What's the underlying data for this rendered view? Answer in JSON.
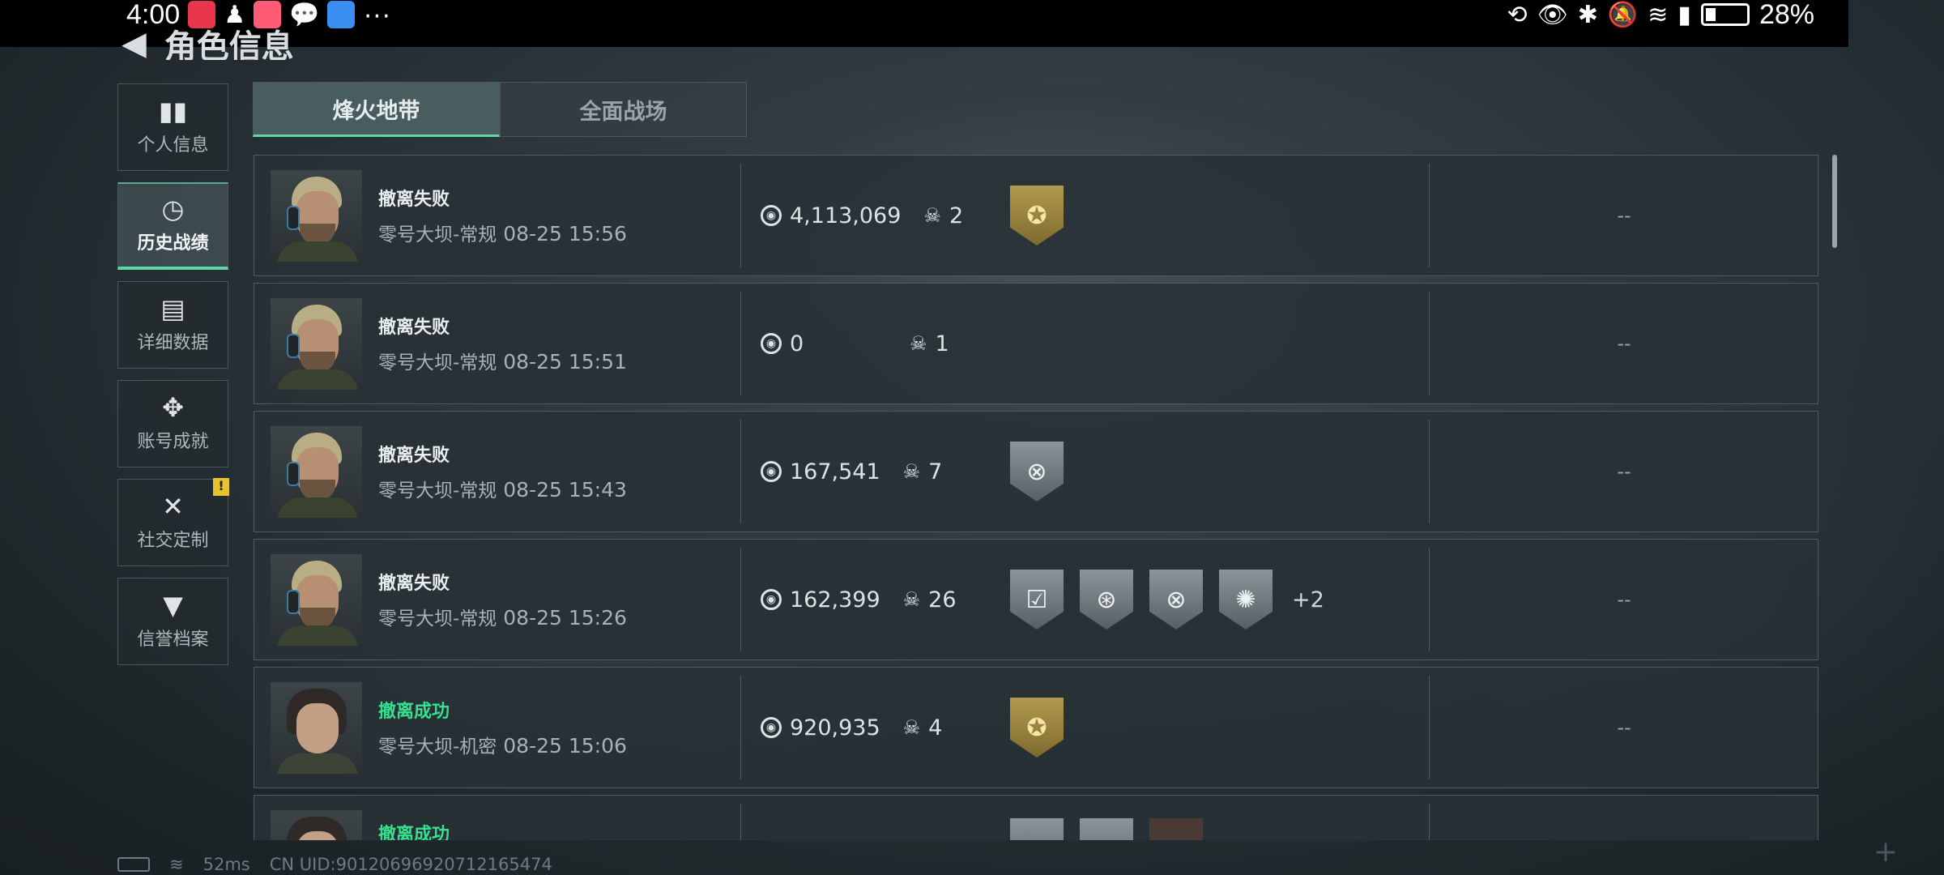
{
  "status_bar": {
    "time": "4:00",
    "more": "···",
    "battery": "28%",
    "colors": {
      "app1": "#e8364a",
      "app2": "#ff5a76",
      "app3": "#3a8ef0"
    }
  },
  "page_title": "角色信息",
  "nav": {
    "items": [
      {
        "label": "个人信息",
        "icon": "bar-chart-icon"
      },
      {
        "label": "历史战绩",
        "icon": "clock-icon"
      },
      {
        "label": "详细数据",
        "icon": "folder-icon"
      },
      {
        "label": "账号成就",
        "icon": "achievement-icon"
      },
      {
        "label": "社交定制",
        "icon": "tools-icon",
        "badge": "!"
      },
      {
        "label": "信誉档案",
        "icon": "shield-icon"
      }
    ],
    "active_index": 1
  },
  "tabs": [
    {
      "label": "烽火地带",
      "active": true
    },
    {
      "label": "全面战场",
      "active": false
    }
  ],
  "records": [
    {
      "status": "撤离失败",
      "success": false,
      "map": "零号大坝-常规",
      "time": "08-25 15:56",
      "value": "4,113,069",
      "kills": "2",
      "medals": [
        "gold"
      ],
      "extra": "",
      "right": "--"
    },
    {
      "status": "撤离失败",
      "success": false,
      "map": "零号大坝-常规",
      "time": "08-25 15:51",
      "value": "0",
      "kills": "1",
      "medals": [],
      "extra": "",
      "right": "--"
    },
    {
      "status": "撤离失败",
      "success": false,
      "map": "零号大坝-常规",
      "time": "08-25 15:43",
      "value": "167,541",
      "kills": "7",
      "medals": [
        "silver"
      ],
      "extra": "",
      "right": "--"
    },
    {
      "status": "撤离失败",
      "success": false,
      "map": "零号大坝-常规",
      "time": "08-25 15:26",
      "value": "162,399",
      "kills": "26",
      "medals": [
        "silver",
        "silver",
        "silver",
        "silver"
      ],
      "extra": "+2",
      "right": "--"
    },
    {
      "status": "撤离成功",
      "success": true,
      "map": "零号大坝-机密",
      "time": "08-25 15:06",
      "value": "920,935",
      "kills": "4",
      "medals": [
        "gold"
      ],
      "extra": "",
      "right": "--"
    },
    {
      "status": "撤离成功",
      "success": true,
      "map": "",
      "time": "",
      "value": "",
      "kills": "",
      "medals": [
        "silver",
        "silver",
        "dark"
      ],
      "extra": "",
      "right": "--"
    }
  ],
  "footer": {
    "ping": "52ms",
    "uid": "CN UID:9012069692071216547​4"
  },
  "colors": {
    "accent_green": "#5fd6a6",
    "success_text": "#37e08f",
    "badge_yellow": "#e8c12f"
  }
}
